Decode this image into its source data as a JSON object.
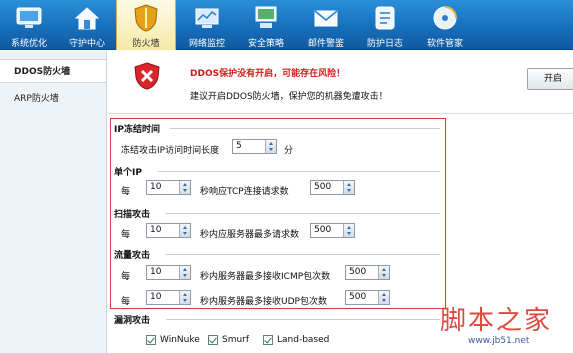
{
  "toolbar": {
    "items": [
      {
        "label": "系统优化",
        "icon": "monitor-icon"
      },
      {
        "label": "守护中心",
        "icon": "home-shield-icon"
      },
      {
        "label": "防火墙",
        "icon": "firewall-shield-icon",
        "active": true
      },
      {
        "label": "网络监控",
        "icon": "network-monitor-icon"
      },
      {
        "label": "安全策略",
        "icon": "security-policy-icon"
      },
      {
        "label": "邮件警鉴",
        "icon": "mail-icon"
      },
      {
        "label": "防护日志",
        "icon": "log-icon"
      },
      {
        "label": "软件管家",
        "icon": "software-disc-icon"
      }
    ]
  },
  "sidebar": {
    "items": [
      {
        "label": "DDOS防火墙",
        "active": true
      },
      {
        "label": "ARP防火墙",
        "active": false
      }
    ]
  },
  "banner": {
    "title": "DDOS保护没有开启，可能存在风险！",
    "desc": "建议开启DDOS防火墙，保护您的机器免遭攻击！",
    "open_label": "开启"
  },
  "settings": {
    "ip_freeze": {
      "title": "IP冻结时间",
      "label": "冻结攻击IP访问时间长度",
      "value": "5",
      "unit": "分"
    },
    "single_ip": {
      "title": "单个IP",
      "per": "每",
      "value": "10",
      "label": "秒响应TCP连接请求数",
      "count": "500"
    },
    "scan_attack": {
      "title": "扫描攻击",
      "per": "每",
      "value": "10",
      "label": "秒内应服务器最多请求数",
      "count": "500"
    },
    "flood_attack": {
      "title": "流量攻击",
      "rows": [
        {
          "per": "每",
          "value": "10",
          "label": "秒内服务器最多接收ICMP包次数",
          "count": "500"
        },
        {
          "per": "每",
          "value": "10",
          "label": "秒内服务器最多接收UDP包次数",
          "count": "500"
        }
      ]
    },
    "vuln_attack": {
      "title": "漏洞攻击",
      "checks": [
        {
          "label": "WinNuke",
          "checked": true
        },
        {
          "label": "Smurf",
          "checked": true
        },
        {
          "label": "Land-based",
          "checked": true
        }
      ]
    }
  },
  "watermark": {
    "text": "脚本之家",
    "url": "www.jb51.net"
  },
  "colors": {
    "toolbar_blue": "#1870bc",
    "warning_red": "#d21a1a",
    "highlight_box": "#d83a3a"
  }
}
